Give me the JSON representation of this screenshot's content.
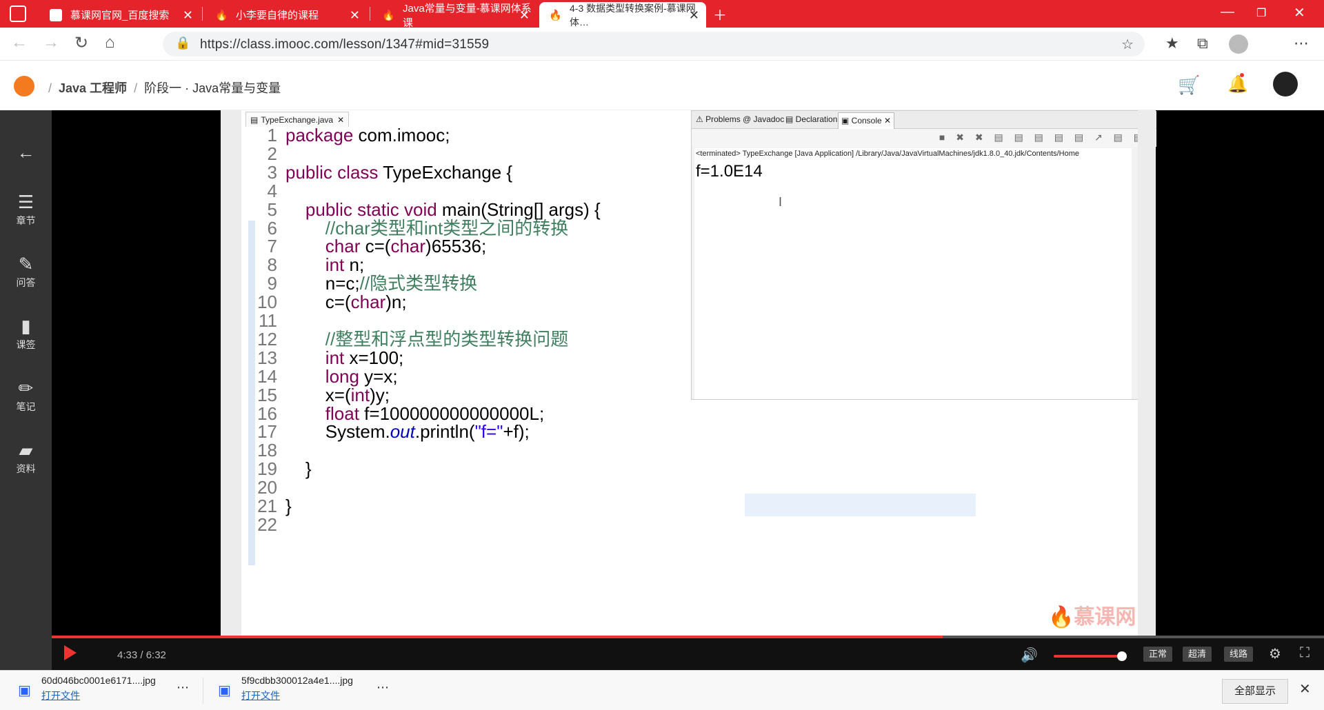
{
  "browser": {
    "tabs": [
      {
        "label": "慕课网官网_百度搜索",
        "active": false
      },
      {
        "label": "小李要自律的课程",
        "active": false
      },
      {
        "label": "Java常量与变量-慕课网体系课",
        "active": false
      },
      {
        "label": "4-3 数据类型转换案例-慕课网体…",
        "active": true
      }
    ],
    "url": "https://class.imooc.com/lesson/1347#mid=31559"
  },
  "site": {
    "breadcrumb": [
      "Java 工程师",
      "阶段一 · Java常量与变量"
    ]
  },
  "sidebar": {
    "items": [
      {
        "label": "",
        "icon": "back-arrow-icon"
      },
      {
        "label": "章节",
        "icon": "chapters-icon"
      },
      {
        "label": "问答",
        "icon": "qa-icon"
      },
      {
        "label": "课签",
        "icon": "bookmark-icon"
      },
      {
        "label": "笔记",
        "icon": "note-icon"
      },
      {
        "label": "资料",
        "icon": "folder-icon"
      }
    ]
  },
  "editor": {
    "tab": "TypeExchange.java",
    "lines": [
      "package com.imooc;",
      "",
      "public class TypeExchange {",
      "",
      "    public static void main(String[] args) {",
      "        //char类型和int类型之间的转换",
      "        char c=(char)65536;",
      "        int n;",
      "        n=c;//隐式类型转换",
      "        c=(char)n;",
      "",
      "        //整型和浮点型的类型转换问题",
      "        int x=100;",
      "        long y=x;",
      "        x=(int)y;",
      "        float f=100000000000000L;",
      "        System.out.println(\"f=\"+f);",
      "",
      "    }",
      "",
      "}",
      ""
    ]
  },
  "console": {
    "tabs": [
      "Problems",
      "Javadoc",
      "Declaration",
      "Console"
    ],
    "terminated": "<terminated> TypeExchange [Java Application] /Library/Java/JavaVirtualMachines/jdk1.8.0_40.jdk/Contents/Home",
    "output": "f=1.0E14"
  },
  "player": {
    "time": "4:33 / 6:32",
    "progress": 0.7,
    "quality": [
      "正常",
      "超清",
      "线路"
    ],
    "watermark": "慕课网"
  },
  "downloads": {
    "items": [
      {
        "file": "60d046bc0001e6171....jpg",
        "action": "打开文件"
      },
      {
        "file": "5f9cdbb300012a4e1....jpg",
        "action": "打开文件"
      }
    ],
    "show_all": "全部显示"
  }
}
